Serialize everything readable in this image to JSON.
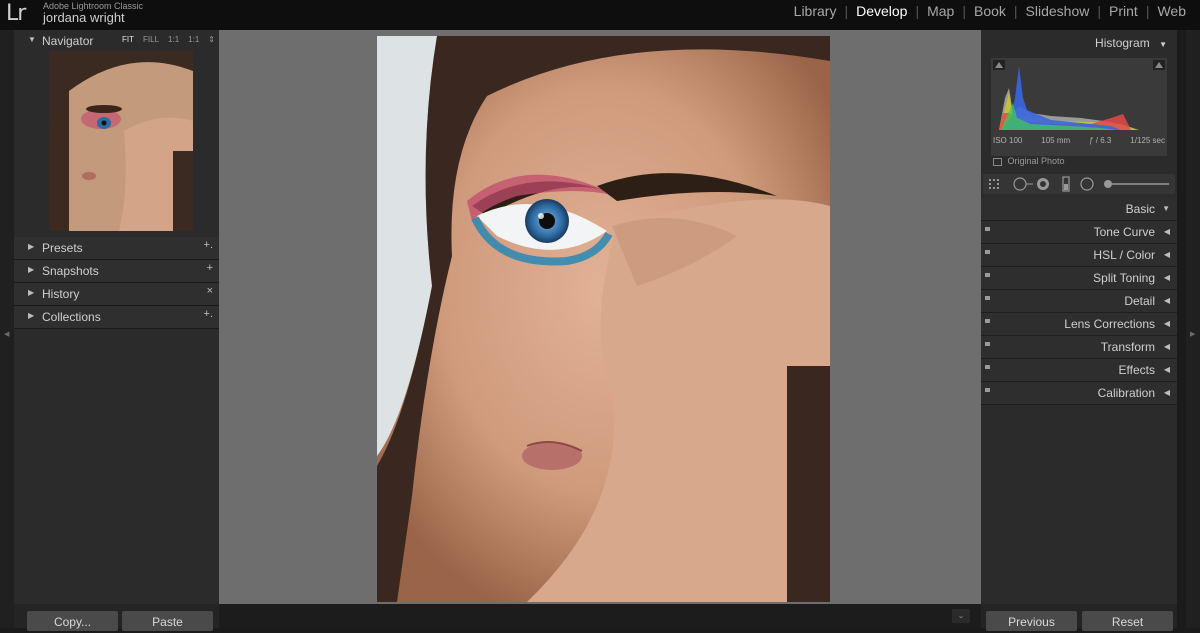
{
  "app": {
    "logo": "Lr",
    "name": "Adobe Lightroom Classic",
    "user": "jordana wright"
  },
  "modules": [
    {
      "label": "Library",
      "active": false
    },
    {
      "label": "Develop",
      "active": true
    },
    {
      "label": "Map",
      "active": false
    },
    {
      "label": "Book",
      "active": false
    },
    {
      "label": "Slideshow",
      "active": false
    },
    {
      "label": "Print",
      "active": false
    },
    {
      "label": "Web",
      "active": false
    }
  ],
  "left_panel": {
    "navigator": {
      "title": "Navigator",
      "options": [
        "FIT",
        "FILL",
        "1:1",
        "1:1"
      ],
      "active_option": "FIT"
    },
    "sections": [
      {
        "label": "Presets",
        "action": "+."
      },
      {
        "label": "Snapshots",
        "action": "+"
      },
      {
        "label": "History",
        "action": "×"
      },
      {
        "label": "Collections",
        "action": "+."
      }
    ],
    "copy_label": "Copy...",
    "paste_label": "Paste"
  },
  "right_panel": {
    "histogram": {
      "title": "Histogram",
      "iso": "ISO 100",
      "focal": "105 mm",
      "aperture": "ƒ / 6.3",
      "shutter": "1/125 sec",
      "original_photo": "Original Photo"
    },
    "sections": [
      {
        "label": "Basic"
      },
      {
        "label": "Tone Curve"
      },
      {
        "label": "HSL / Color"
      },
      {
        "label": "Split Toning"
      },
      {
        "label": "Detail"
      },
      {
        "label": "Lens Corrections"
      },
      {
        "label": "Transform"
      },
      {
        "label": "Effects"
      },
      {
        "label": "Calibration"
      }
    ],
    "previous_label": "Previous",
    "reset_label": "Reset"
  },
  "colors": {
    "topbar": "#0e0e0e",
    "panel": "#2b2b2b",
    "center_bg": "#6e6e6e",
    "button": "#4a4a4a"
  }
}
